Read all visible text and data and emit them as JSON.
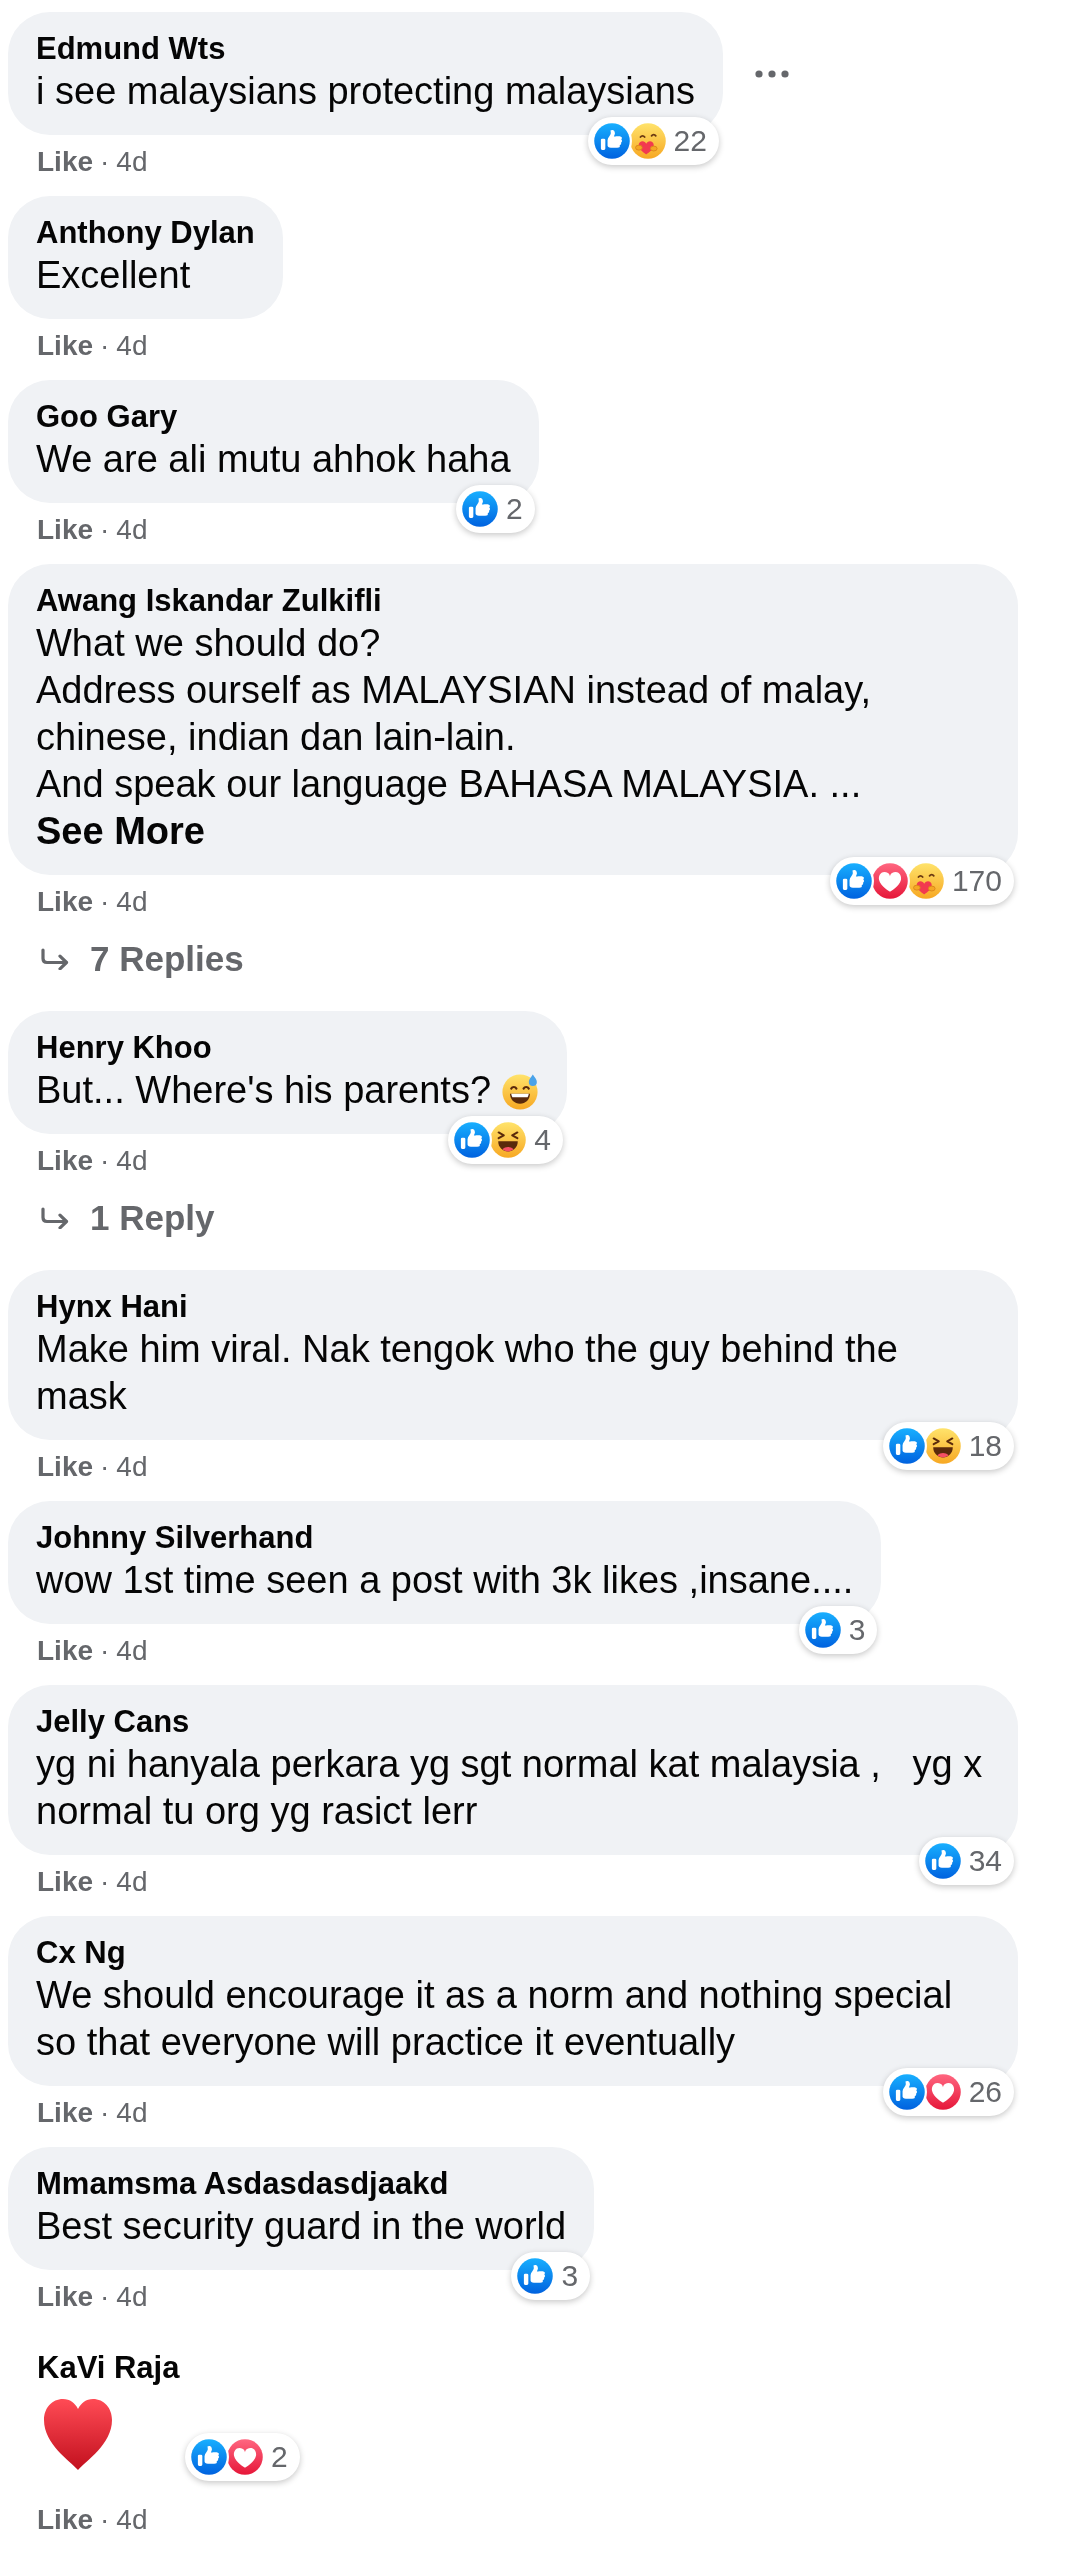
{
  "comments": [
    {
      "kind": "text",
      "author": "Edmund Wts",
      "text": "i see malaysians protecting malaysians",
      "more_options": true,
      "reactions": {
        "items": [
          {
            "kind": "like"
          },
          {
            "kind": "care"
          }
        ],
        "count": "22"
      },
      "like": "Like",
      "separator": "·",
      "time": "4d"
    },
    {
      "kind": "text",
      "author": "Anthony Dylan",
      "text": "Excellent",
      "more_options": false,
      "like": "Like",
      "separator": "·",
      "time": "4d"
    },
    {
      "kind": "text",
      "author": "Goo Gary",
      "text": "We are ali mutu ahhok haha",
      "more_options": false,
      "reactions": {
        "items": [
          {
            "kind": "like"
          }
        ],
        "count": "2"
      },
      "like": "Like",
      "separator": "·",
      "time": "4d"
    },
    {
      "kind": "text",
      "author": "Awang Iskandar Zulkifli",
      "text": "What we should do?\nAddress ourself as MALAYSIAN instead of malay, chinese, indian dan lain-lain.\nAnd speak our language BAHASA MALAYSIA. ...",
      "see_more": "See More",
      "more_options": false,
      "reactions": {
        "items": [
          {
            "kind": "like"
          },
          {
            "kind": "love"
          },
          {
            "kind": "care"
          }
        ],
        "count": "170"
      },
      "like": "Like",
      "separator": "·",
      "time": "4d",
      "replies": "7 Replies"
    },
    {
      "kind": "text",
      "author": "Henry Khoo",
      "text": "But... Where's his parents?",
      "emoji": {
        "kind": "grinning_sweat"
      },
      "more_options": false,
      "reactions": {
        "items": [
          {
            "kind": "like"
          },
          {
            "kind": "haha"
          }
        ],
        "count": "4"
      },
      "like": "Like",
      "separator": "·",
      "time": "4d",
      "replies": "1 Reply"
    },
    {
      "kind": "text",
      "author": "Hynx Hani",
      "text": "Make him viral. Nak tengok who the guy behind the mask",
      "more_options": false,
      "reactions": {
        "items": [
          {
            "kind": "like"
          },
          {
            "kind": "haha"
          }
        ],
        "count": "18"
      },
      "like": "Like",
      "separator": "·",
      "time": "4d"
    },
    {
      "kind": "text",
      "author": "Johnny Silverhand",
      "text": "wow 1st time seen a post with 3k likes ,insane....",
      "more_options": false,
      "reactions": {
        "items": [
          {
            "kind": "like"
          }
        ],
        "count": "3"
      },
      "like": "Like",
      "separator": "·",
      "time": "4d"
    },
    {
      "kind": "text",
      "author": "Jelly Cans",
      "text": "yg ni hanyala perkara yg sgt normal kat malaysia ,   yg x normal tu org yg rasict lerr",
      "more_options": false,
      "reactions": {
        "items": [
          {
            "kind": "like"
          }
        ],
        "count": "34"
      },
      "like": "Like",
      "separator": "·",
      "time": "4d"
    },
    {
      "kind": "text",
      "author": "Cx Ng",
      "text": "We should encourage it as a norm and nothing special so that everyone will practice it eventually",
      "more_options": false,
      "reactions": {
        "items": [
          {
            "kind": "like"
          },
          {
            "kind": "love"
          }
        ],
        "count": "26"
      },
      "like": "Like",
      "separator": "·",
      "time": "4d"
    },
    {
      "kind": "text",
      "author": "Mmamsma Asdasdasdjaakd",
      "text": "Best security guard in the world",
      "more_options": false,
      "reactions": {
        "items": [
          {
            "kind": "like"
          }
        ],
        "count": "3"
      },
      "like": "Like",
      "separator": "·",
      "time": "4d"
    },
    {
      "kind": "emoji",
      "author": "KaVi Raja",
      "emoji": {
        "kind": "heart"
      },
      "more_options": false,
      "reactions": {
        "items": [
          {
            "kind": "like"
          },
          {
            "kind": "love"
          }
        ],
        "count": "2"
      },
      "like": "Like",
      "separator": "·",
      "time": "4d"
    }
  ]
}
